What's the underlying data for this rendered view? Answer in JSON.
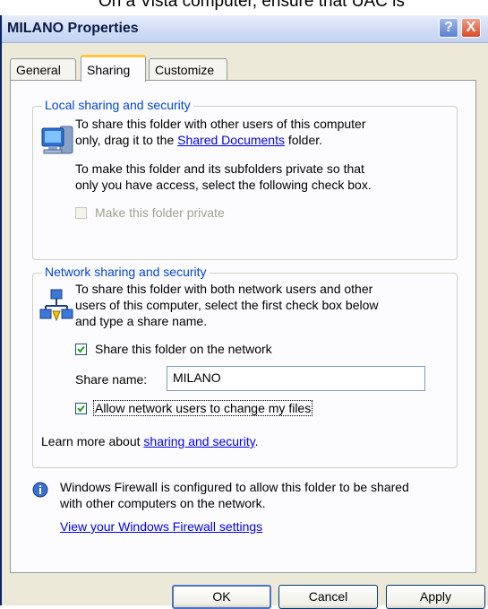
{
  "backdrop_text": "On a Vista computer, ensure that UAC is",
  "window": {
    "title": "MILANO Properties",
    "help_glyph": "?",
    "close_glyph": "X"
  },
  "tabs": [
    {
      "label": "General",
      "active": false
    },
    {
      "label": "Sharing",
      "active": true
    },
    {
      "label": "Customize",
      "active": false
    }
  ],
  "local": {
    "legend": "Local sharing and security",
    "text1_a": "To share this folder with other users of this computer",
    "text1_b": "only, drag it to the",
    "shared_docs_link": "Shared Documents",
    "text1_c": "folder.",
    "text2_a": "To make this folder and its subfolders private so that",
    "text2_b": "only you have access, select the following check box.",
    "private_checkbox_label": "Make this folder private",
    "private_checked": false
  },
  "network": {
    "legend": "Network sharing and security",
    "text_a": "To share this folder with both network users and other",
    "text_b": "users of this computer, select the first check box below",
    "text_c": "and type a share name.",
    "share_checkbox_label": "Share this folder on the network",
    "share_checked": true,
    "share_name_label": "Share name:",
    "share_name_value": "MILANO",
    "allow_checkbox_label": "Allow network users to change my files",
    "allow_checked": true,
    "learn_more_prefix": "Learn more about",
    "learn_more_link": "sharing and security",
    "learn_more_suffix": "."
  },
  "firewall": {
    "text_a": "Windows Firewall is configured to allow this folder to be shared",
    "text_b": "with other computers on the network.",
    "settings_link": "View your Windows Firewall settings"
  },
  "buttons": {
    "ok": "OK",
    "cancel": "Cancel",
    "apply": "Apply"
  },
  "colors": {
    "accent_tab": "#ffc83c",
    "link": "#0000ee",
    "legend": "#0046d5"
  }
}
